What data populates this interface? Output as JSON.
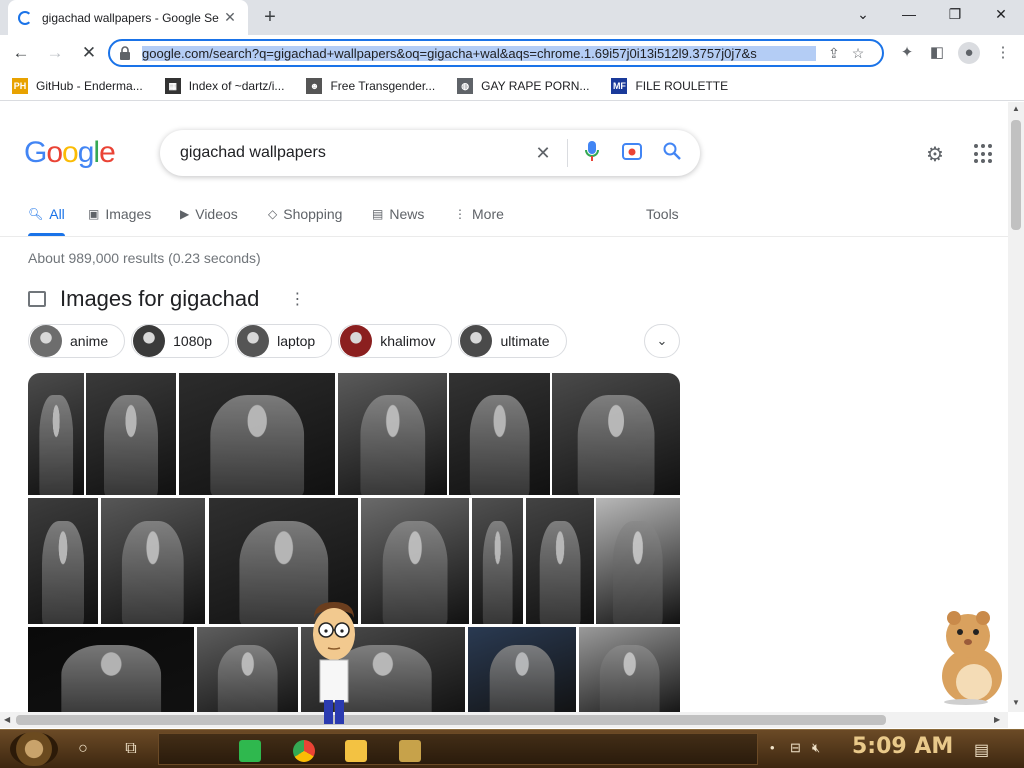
{
  "window": {
    "tab_title": "gigachad wallpapers - Google Se",
    "url": "google.com/search?q=gigachad+wallpapers&oq=gigacha+wal&aqs=chrome.1.69i57j0i13i512l9.3757j0j7&s"
  },
  "bookmarks": [
    {
      "label": "GitHub - Enderma...",
      "icon": "ph-icon",
      "color": "#e8a200",
      "glyph": "PH"
    },
    {
      "label": "Index of ~dartz/i...",
      "icon": "film-icon",
      "color": "#333333",
      "glyph": "▦"
    },
    {
      "label": "Free Transgender...",
      "icon": "mask-icon",
      "color": "#555555",
      "glyph": "☻"
    },
    {
      "label": "GAY RAPE PORN...",
      "icon": "globe-icon",
      "color": "#5f6368",
      "glyph": "◍"
    },
    {
      "label": "FILE ROULETTE",
      "icon": "mf-icon",
      "color": "#1a3a9a",
      "glyph": "MF"
    }
  ],
  "search": {
    "query": "gigachad wallpapers"
  },
  "logo": [
    "G",
    "o",
    "o",
    "g",
    "l",
    "e"
  ],
  "logo_colors": [
    "#4285f4",
    "#ea4335",
    "#fbbc05",
    "#4285f4",
    "#34a853",
    "#ea4335"
  ],
  "nav_tabs": [
    {
      "label": "All",
      "icon": "search-icon",
      "glyph": "🔍︎"
    },
    {
      "label": "Images",
      "icon": "image-icon",
      "glyph": "▣"
    },
    {
      "label": "Videos",
      "icon": "play-icon",
      "glyph": "▶"
    },
    {
      "label": "Shopping",
      "icon": "tag-icon",
      "glyph": "◇"
    },
    {
      "label": "News",
      "icon": "news-icon",
      "glyph": "▤"
    },
    {
      "label": "More",
      "icon": "more-icon",
      "glyph": "⋮"
    }
  ],
  "tools_label": "Tools",
  "result_stats": "About 989,000 results (0.23 seconds)",
  "images_section": {
    "title": "Images for gigachad"
  },
  "chips": [
    "anime",
    "1080p",
    "laptop",
    "khalimov",
    "ultimate"
  ],
  "taskbar": {
    "clock": "5:09 AM"
  }
}
